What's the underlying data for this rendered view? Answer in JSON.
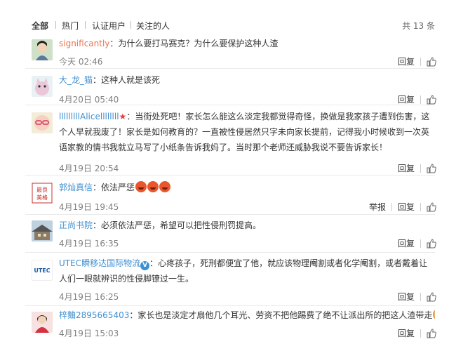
{
  "tabs": [
    "全部",
    "热门",
    "认证用户",
    "关注的人"
  ],
  "total_count": "共 13 条",
  "action_labels": {
    "reply": "回复",
    "report": "举报"
  },
  "comments": [
    {
      "user": "significantly",
      "sep": "：",
      "text": "为什么要打马赛克？为什么要保护这种人渣",
      "time": "今天 02:46"
    },
    {
      "user": "大_龙_猫",
      "sep": "：",
      "text": "这种人就是该死",
      "time": "4月20日 05:40"
    },
    {
      "user": "lllllllllAlicellllllll",
      "sep": "：",
      "text": "当街处死吧！家长怎么能这么淡定我都觉得奇怪，换做是我家孩子遭到伤害，这个人早就我废了！家长是如何教育的？一直被性侵居然只字未向家长提前，记得我小时候收到一次英语家教的情书我就立马写了小纸条告诉我妈了。当时那个老师还威胁我说不要告诉家长！",
      "time": "4月19日 20:54"
    },
    {
      "user": "郭灿真信",
      "sep": "：",
      "text": "依法严惩",
      "time": "4月19日 19:45"
    },
    {
      "user": "正尚书院",
      "sep": "：",
      "text": "必须依法严惩，希望可以把性侵刑罚提高。",
      "time": "4月19日 16:35"
    },
    {
      "user": "UTEC瞬移达国际物流",
      "sep": "：",
      "text": "心疼孩子，死刑都便宜了他，就应该物理阉割或者化学阉割，或者戴着让人们一眼就辨识的性侵脚镣过一生。",
      "time": "4月19日 16:25"
    },
    {
      "user": "梓麯2895665403",
      "sep": "：",
      "text": "家长也是淡定才扇他几个耳光、劳资不把他踢费了绝不让派出所的把这人渣带走",
      "time": "4月19日 15:03"
    }
  ],
  "avatar_badge_text": [
    "最良",
    "美格"
  ],
  "avatar_logo_text": "UTEC",
  "colors": {
    "accent": "#eb7350",
    "verified": "#3f8fd1",
    "time": "#808080"
  },
  "icons": {
    "like": "thumb-up-icon",
    "member": "star-badge-icon",
    "verified": "verified-v-icon"
  }
}
